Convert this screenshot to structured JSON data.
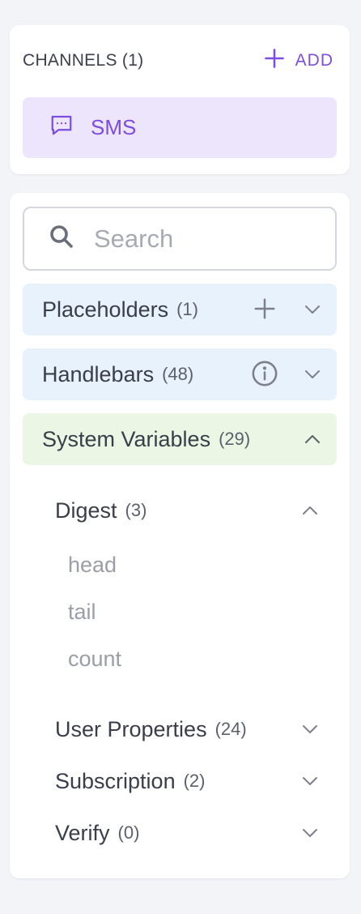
{
  "channels": {
    "title": "CHANNELS (1)",
    "add_label": "ADD",
    "items": [
      {
        "label": "SMS",
        "icon": "message-icon"
      }
    ]
  },
  "search": {
    "placeholder": "Search",
    "value": ""
  },
  "groups": [
    {
      "label": "Placeholders",
      "count": "(1)",
      "color": "#e7f2fd",
      "actions": [
        "plus-icon",
        "chevron-down-icon"
      ],
      "expanded": false
    },
    {
      "label": "Handlebars",
      "count": "(48)",
      "color": "#e7f2fd",
      "actions": [
        "info-icon",
        "chevron-down-icon"
      ],
      "expanded": false
    },
    {
      "label": "System Variables",
      "count": "(29)",
      "color": "#ebf7e4",
      "actions": [
        "chevron-up-icon"
      ],
      "expanded": true
    }
  ],
  "system_variables": {
    "subgroups": [
      {
        "label": "Digest",
        "count": "(3)",
        "expanded": true,
        "items": [
          "head",
          "tail",
          "count"
        ]
      },
      {
        "label": "User Properties",
        "count": "(24)",
        "expanded": false
      },
      {
        "label": "Subscription",
        "count": "(2)",
        "expanded": false
      },
      {
        "label": "Verify",
        "count": "(0)",
        "expanded": false
      }
    ]
  },
  "colors": {
    "accent": "#7c4de0",
    "channel_bg": "#ede5fc",
    "page_bg": "#f3f4f8",
    "icon_gray": "#7d808b"
  }
}
